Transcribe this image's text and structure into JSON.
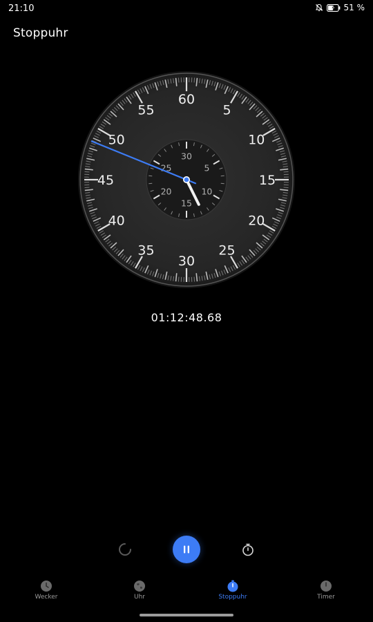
{
  "status_bar": {
    "time": "21:10",
    "icons": [
      "bell-off-icon",
      "battery-charging-icon"
    ],
    "battery_text": "51 %"
  },
  "header": {
    "title": "Stoppuhr"
  },
  "dial": {
    "outer_numbers": [
      "60",
      "5",
      "10",
      "15",
      "20",
      "25",
      "30",
      "35",
      "40",
      "45",
      "50",
      "55"
    ],
    "inner_numbers": [
      "30",
      "5",
      "10",
      "15",
      "20",
      "25"
    ],
    "second_hand_value_seconds": 48.68,
    "minute_hand_value_minutes": 12.8,
    "colors": {
      "accent": "#3d7cf5",
      "dial_face": "#2a2a2a",
      "dial_border": "#4a4a4a",
      "tick": "#9a9a9a"
    }
  },
  "timer": {
    "elapsed": "01:12:48.68"
  },
  "controls": {
    "reset_icon": "reset-spinner-icon",
    "pause_icon": "pause-icon",
    "lap_icon": "stopwatch-icon",
    "accent": "#3d7cf5"
  },
  "nav": {
    "items": [
      {
        "label": "Wecker",
        "icon": "alarm-clock-icon",
        "active": false
      },
      {
        "label": "Uhr",
        "icon": "globe-icon",
        "active": false
      },
      {
        "label": "Stoppuhr",
        "icon": "stopwatch-icon",
        "active": true
      },
      {
        "label": "Timer",
        "icon": "timer-icon",
        "active": false
      }
    ]
  }
}
